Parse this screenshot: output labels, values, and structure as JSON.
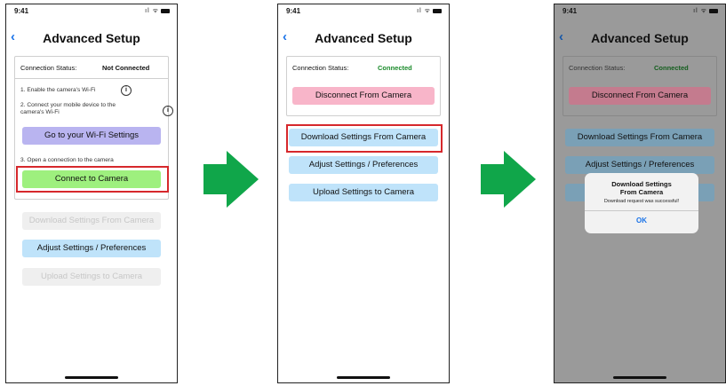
{
  "status_bar": {
    "time": "9:41",
    "icons": "ıl ᯤ"
  },
  "nav": {
    "back": "‹",
    "title": "Advanced Setup"
  },
  "screen1": {
    "connection_label": "Connection Status:",
    "connection_value": "Not Connected",
    "step1": "1. Enable the camera's Wi-Fi",
    "step2_line1": "2. Connect your mobile device to the",
    "step2_line2": "camera's Wi-Fi",
    "wifi_button": "Go to your Wi-Fi Settings",
    "step3": "3. Open a connection to the camera",
    "connect_button": "Connect to Camera",
    "download_button": "Download Settings From Camera",
    "adjust_button": "Adjust Settings / Preferences",
    "upload_button": "Upload Settings to Camera"
  },
  "screen2": {
    "connection_label": "Connection Status:",
    "connection_value": "Connected",
    "disconnect_button": "Disconnect From Camera",
    "download_button": "Download Settings From Camera",
    "adjust_button": "Adjust Settings / Preferences",
    "upload_button": "Upload Settings to Camera"
  },
  "screen3": {
    "connection_label": "Connection Status:",
    "connection_value": "Connected",
    "disconnect_button": "Disconnect From Camera",
    "download_button": "Download Settings From Camera",
    "adjust_button": "Adjust Settings / Preferences",
    "alert_title_line1": "Download Settings",
    "alert_title_line2": "From Camera",
    "alert_message": "Download request was successful!",
    "alert_ok": "OK"
  },
  "info_icon": "i",
  "colors": {
    "connected": "#1a8a2a",
    "arrow": "#10a64a",
    "highlight": "#d6282c"
  }
}
